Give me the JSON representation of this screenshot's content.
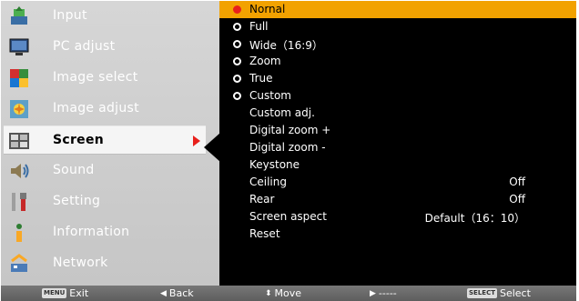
{
  "main_menu": {
    "items": [
      {
        "label": "Input",
        "icon": "input-icon",
        "active": false
      },
      {
        "label": "PC adjust",
        "icon": "monitor-icon",
        "active": false
      },
      {
        "label": "Image select",
        "icon": "image-select-icon",
        "active": false
      },
      {
        "label": "Image adjust",
        "icon": "image-adjust-icon",
        "active": false
      },
      {
        "label": "Screen",
        "icon": "screen-icon",
        "active": true
      },
      {
        "label": "Sound",
        "icon": "speaker-icon",
        "active": false
      },
      {
        "label": "Setting",
        "icon": "tools-icon",
        "active": false
      },
      {
        "label": "Information",
        "icon": "info-icon",
        "active": false
      },
      {
        "label": "Network",
        "icon": "network-icon",
        "active": false
      }
    ]
  },
  "screen_menu": {
    "items": [
      {
        "label": "Nornal",
        "bullet": "selected",
        "value": ""
      },
      {
        "label": "Full",
        "bullet": "radio",
        "value": ""
      },
      {
        "label": "Wide（16:9）",
        "bullet": "radio",
        "value": ""
      },
      {
        "label": "Zoom",
        "bullet": "radio",
        "value": ""
      },
      {
        "label": "True",
        "bullet": "radio",
        "value": ""
      },
      {
        "label": "Custom",
        "bullet": "radio",
        "value": ""
      },
      {
        "label": "Custom adj.",
        "bullet": "none",
        "value": ""
      },
      {
        "label": "Digital zoom +",
        "bullet": "none",
        "value": ""
      },
      {
        "label": "Digital zoom -",
        "bullet": "none",
        "value": ""
      },
      {
        "label": "Keystone",
        "bullet": "none",
        "value": ""
      },
      {
        "label": "Ceiling",
        "bullet": "none",
        "value": "Off"
      },
      {
        "label": "Rear",
        "bullet": "none",
        "value": "Off"
      },
      {
        "label": "Screen aspect",
        "bullet": "none",
        "value": "Default（16：10）"
      },
      {
        "label": "Reset",
        "bullet": "none",
        "value": ""
      }
    ]
  },
  "bottom_bar": {
    "exit_key": "MENU",
    "exit_label": "Exit",
    "back_glyph": "◀",
    "back_label": "Back",
    "move_glyph": "⬍",
    "move_label": "Move",
    "next_glyph": "▶",
    "next_label": "-----",
    "select_key": "SELECT",
    "select_label": "Select"
  },
  "colors": {
    "highlight": "#f2a200",
    "accent_red": "#e8201c",
    "panel_gray": "#cfcfcf",
    "submenu_bg": "#000000"
  }
}
